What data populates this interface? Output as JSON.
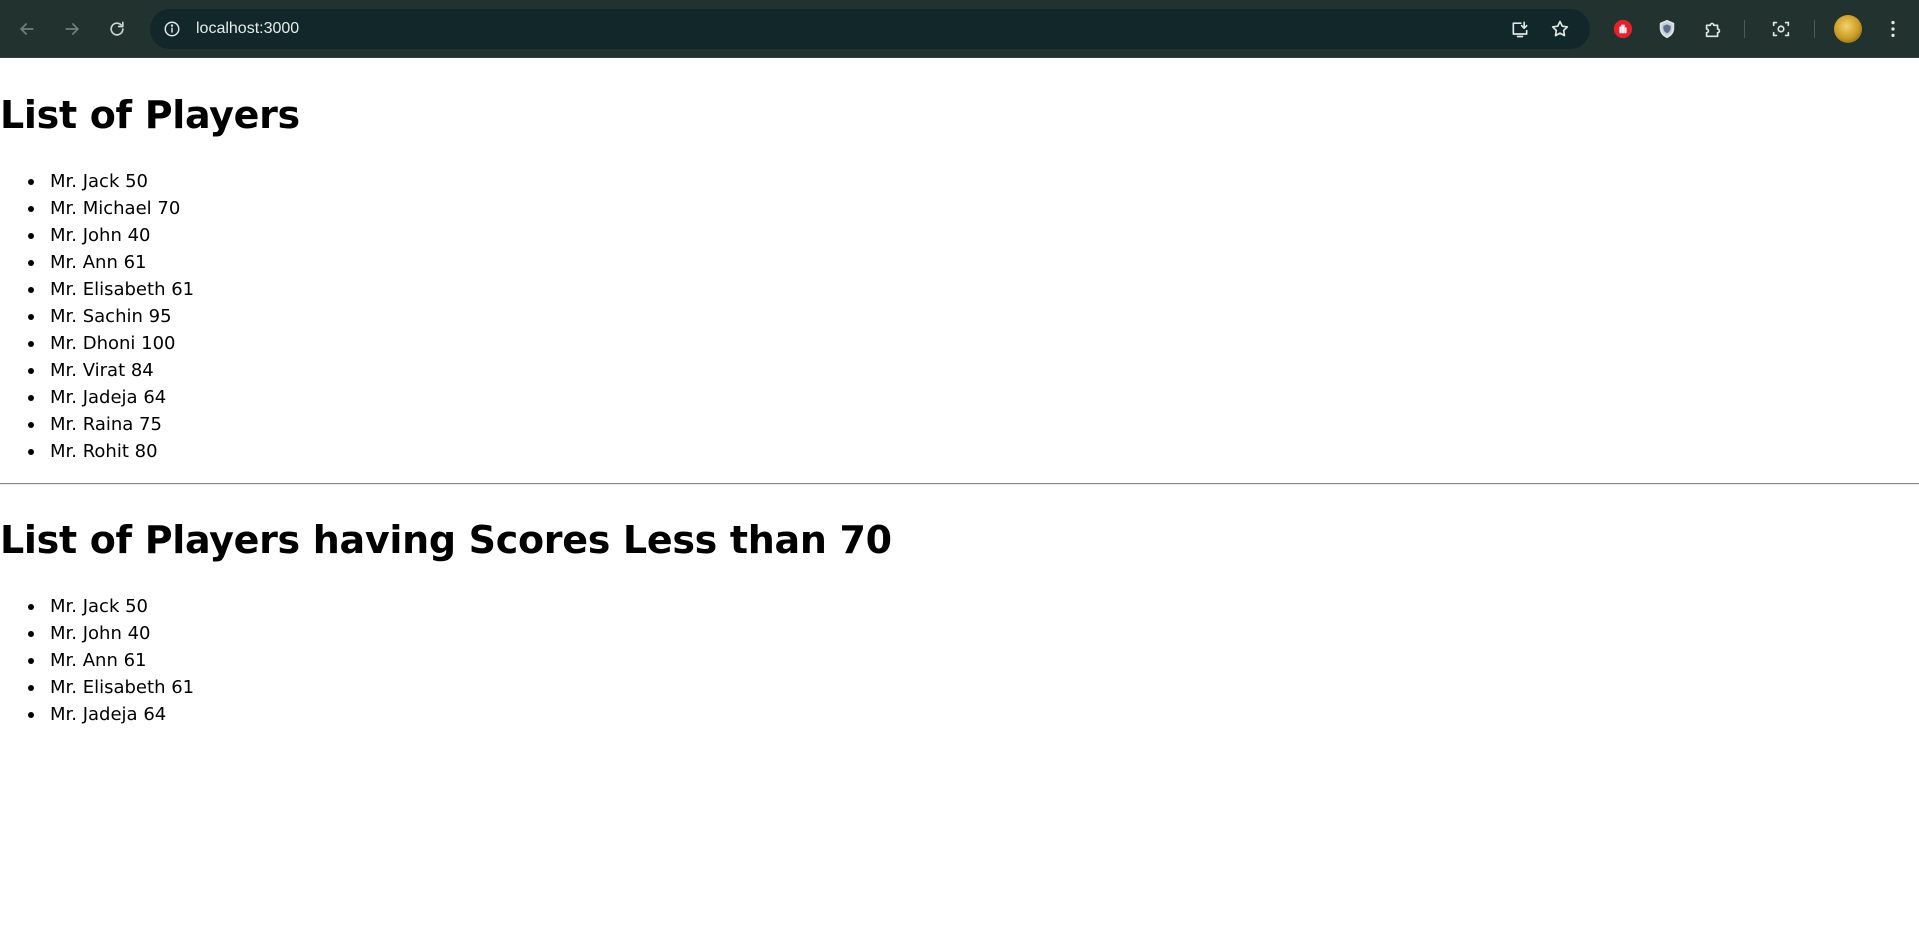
{
  "browser": {
    "url": "localhost:3000",
    "icons": {
      "back": "arrow-left-icon",
      "forward": "arrow-right-icon",
      "reload": "reload-icon",
      "site_info": "info-icon",
      "install": "install-app-icon",
      "bookmark": "star-icon",
      "extension_red": "stop-hand-icon",
      "extension_shield": "shield-icon",
      "extensions": "puzzle-icon",
      "lens": "camera-search-icon",
      "menu": "kebab-menu-icon"
    },
    "colors": {
      "toolbar": "#21322f",
      "omnibox": "#12272a"
    }
  },
  "page": {
    "all_players": {
      "heading": "List of Players",
      "items": [
        "Mr. Jack 50",
        "Mr. Michael 70",
        "Mr. John 40",
        "Mr. Ann 61",
        "Mr. Elisabeth 61",
        "Mr. Sachin 95",
        "Mr. Dhoni 100",
        "Mr. Virat 84",
        "Mr. Jadeja 64",
        "Mr. Raina 75",
        "Mr. Rohit 80"
      ]
    },
    "low_scores": {
      "heading": "List of Players having Scores Less than 70",
      "items": [
        "Mr. Jack 50",
        "Mr. John 40",
        "Mr. Ann 61",
        "Mr. Elisabeth 61",
        "Mr. Jadeja 64"
      ]
    }
  }
}
